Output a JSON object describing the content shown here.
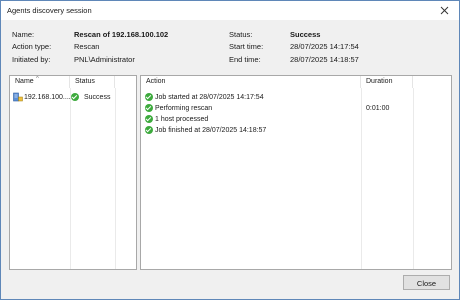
{
  "window": {
    "title": "Agents discovery session"
  },
  "info": {
    "name_label": "Name:",
    "name_value": "Rescan of 192.168.100.102",
    "action_type_label": "Action type:",
    "action_type_value": "Rescan",
    "initiated_by_label": "Initiated by:",
    "initiated_by_value": "PNL\\Administrator",
    "status_label": "Status:",
    "status_value": "Success",
    "start_time_label": "Start time:",
    "start_time_value": "28/07/2025 14:17:54",
    "end_time_label": "End time:",
    "end_time_value": "28/07/2025 14:18:57"
  },
  "hosts_table": {
    "columns": [
      "Name",
      "Status"
    ],
    "rows": [
      {
        "name": "192.168.100....",
        "status": "Success",
        "icon": "server-icon",
        "status_icon": "success-check-icon"
      }
    ]
  },
  "log_table": {
    "columns": [
      "Action",
      "Duration"
    ],
    "rows": [
      {
        "action": "Job started at 28/07/2025 14:17:54",
        "duration": "",
        "icon": "success-check-icon"
      },
      {
        "action": "Performing rescan",
        "duration": "0:01:00",
        "icon": "success-check-icon"
      },
      {
        "action": "1 host processed",
        "duration": "",
        "icon": "success-check-icon"
      },
      {
        "action": "Job finished at 28/07/2025 14:18:57",
        "duration": "",
        "icon": "success-check-icon"
      }
    ]
  },
  "footer": {
    "close_label": "Close"
  },
  "colors": {
    "success": "#3daa3d",
    "border": "#5f87b8"
  }
}
